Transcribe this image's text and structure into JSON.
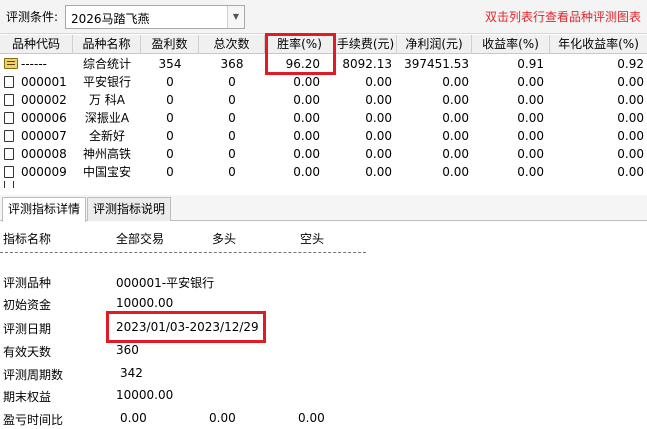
{
  "toolbar": {
    "condition_label": "评测条件:",
    "strategy_value": "2026马踏飞燕",
    "hint": "双击列表行查看品种评测图表"
  },
  "table": {
    "headers": [
      "品种代码",
      "品种名称",
      "盈利数",
      "总次数",
      "胜率(%)",
      "手续费(元)",
      "净利润(元)",
      "收益率(%)",
      "年化收益率(%)"
    ],
    "summary_row": {
      "code": "------",
      "name": "综合统计",
      "wins": "354",
      "total": "368",
      "win_rate": "96.20",
      "fee": "8092.13",
      "net_profit": "397451.53",
      "return": "0.91",
      "annual_return": "0.92"
    },
    "rows": [
      {
        "code": "000001",
        "name": "平安银行",
        "wins": "0",
        "total": "0",
        "win_rate": "0.00",
        "fee": "0.00",
        "net_profit": "0.00",
        "return": "0.00",
        "annual_return": "0.00"
      },
      {
        "code": "000002",
        "name": "万 科A",
        "wins": "0",
        "total": "0",
        "win_rate": "0.00",
        "fee": "0.00",
        "net_profit": "0.00",
        "return": "0.00",
        "annual_return": "0.00"
      },
      {
        "code": "000006",
        "name": "深振业A",
        "wins": "0",
        "total": "0",
        "win_rate": "0.00",
        "fee": "0.00",
        "net_profit": "0.00",
        "return": "0.00",
        "annual_return": "0.00"
      },
      {
        "code": "000007",
        "name": "全新好",
        "wins": "0",
        "total": "0",
        "win_rate": "0.00",
        "fee": "0.00",
        "net_profit": "0.00",
        "return": "0.00",
        "annual_return": "0.00"
      },
      {
        "code": "000008",
        "name": "神州高铁",
        "wins": "0",
        "total": "0",
        "win_rate": "0.00",
        "fee": "0.00",
        "net_profit": "0.00",
        "return": "0.00",
        "annual_return": "0.00"
      },
      {
        "code": "000009",
        "name": "中国宝安",
        "wins": "0",
        "total": "0",
        "win_rate": "0.00",
        "fee": "0.00",
        "net_profit": "0.00",
        "return": "0.00",
        "annual_return": "0.00"
      }
    ]
  },
  "tabs": {
    "detail": "评测指标详情",
    "explain": "评测指标说明"
  },
  "detail": {
    "header": {
      "name": "指标名称",
      "all": "全部交易",
      "long": "多头",
      "short": "空头"
    },
    "items": [
      {
        "label": "评测品种",
        "value": "000001-平安银行"
      },
      {
        "label": "初始资金",
        "value": "10000.00"
      },
      {
        "label": "评测日期",
        "value": "2023/01/03-2023/12/29"
      },
      {
        "label": "有效天数",
        "value": "360"
      },
      {
        "label": "评测周期数",
        "value": "342"
      },
      {
        "label": "期末权益",
        "value": "10000.00"
      },
      {
        "label": "盈亏时间比",
        "value": "0.00",
        "long": "0.00",
        "short": "0.00"
      }
    ]
  },
  "colors": {
    "highlight": "#e01b24",
    "hint_text": "#e0262b"
  },
  "icons": {
    "summary_row": "folder-icon",
    "stock_rows": "document-icon",
    "dropdown": "chevron-down-icon"
  }
}
